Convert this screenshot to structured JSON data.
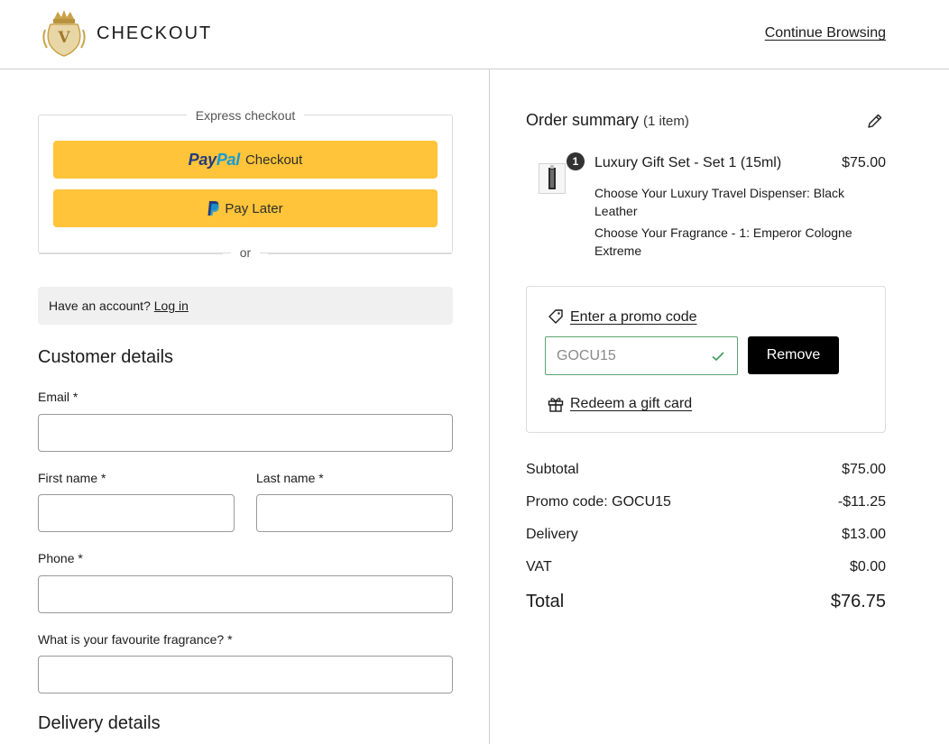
{
  "header": {
    "title": "CHECKOUT",
    "continue_label": "Continue Browsing"
  },
  "express": {
    "label": "Express checkout",
    "paypal_word_1": "Pay",
    "paypal_word_2": "Pal",
    "paypal_checkout_label": "Checkout",
    "pay_later_label": "Pay Later",
    "or_label": "or"
  },
  "account": {
    "prompt": "Have an account?",
    "login_label": "Log in"
  },
  "customer": {
    "heading": "Customer details",
    "email_label": "Email *",
    "email_value": "",
    "first_name_label": "First name *",
    "first_name_value": "",
    "last_name_label": "Last name *",
    "last_name_value": "",
    "phone_label": "Phone *",
    "phone_value": "",
    "fragrance_label": "What is your favourite fragrance? *",
    "fragrance_value": ""
  },
  "delivery": {
    "heading": "Delivery details"
  },
  "summary": {
    "title": "Order summary",
    "count": "(1 item)",
    "item": {
      "quantity": "1",
      "name": "Luxury Gift Set - Set 1 (15ml)",
      "price": "$75.00",
      "option_1": "Choose Your Luxury Travel Dispenser: Black Leather",
      "option_2": "Choose Your Fragrance - 1: Emperor Cologne Extreme"
    },
    "promo": {
      "link_label": "Enter a promo code",
      "code_value": "GOCU15",
      "remove_label": "Remove",
      "gift_label": "Redeem a gift card"
    },
    "totals": {
      "subtotal_label": "Subtotal",
      "subtotal_value": "$75.00",
      "promo_label": "Promo code: GOCU15",
      "promo_value": "-$11.25",
      "delivery_label": "Delivery",
      "delivery_value": "$13.00",
      "vat_label": "VAT",
      "vat_value": "$0.00",
      "total_label": "Total",
      "total_value": "$76.75"
    }
  },
  "colors": {
    "paypal_yellow": "#ffc439",
    "paypal_dark_blue": "#253b80",
    "paypal_light_blue": "#179bd7",
    "promo_valid_green": "#5aa66f",
    "logo_gold": "#c9a24b"
  }
}
